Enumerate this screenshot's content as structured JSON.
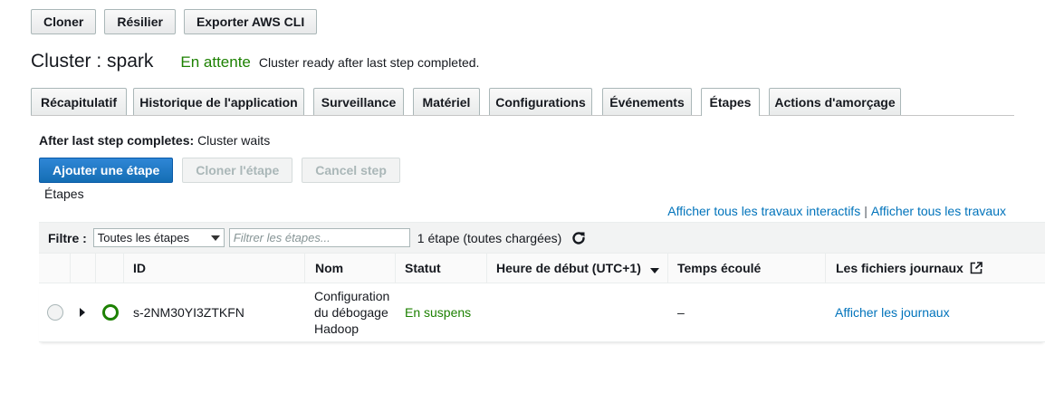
{
  "toolbar": {
    "clone_label": "Cloner",
    "terminate_label": "Résilier",
    "export_label": "Exporter AWS CLI"
  },
  "cluster": {
    "title": "Cluster : spark",
    "state": "En attente",
    "message": "Cluster ready after last step completed."
  },
  "tabs": [
    {
      "label": "Récapitulatif",
      "active": false
    },
    {
      "label": "Historique de l'application",
      "active": false
    },
    {
      "label": "Surveillance",
      "active": false
    },
    {
      "label": "Matériel",
      "active": false
    },
    {
      "label": "Configurations",
      "active": false
    },
    {
      "label": "Événements",
      "active": false
    },
    {
      "label": "Étapes",
      "active": true
    },
    {
      "label": "Actions d'amorçage",
      "active": false
    }
  ],
  "steps_panel": {
    "after_label": "After last step completes:",
    "after_value": "Cluster waits",
    "add_step_label": "Ajouter une étape",
    "clone_step_label": "Cloner l'étape",
    "cancel_step_label": "Cancel step",
    "section_label": "Étapes",
    "link_interactive": "Afficher tous les travaux interactifs",
    "link_separator": "|",
    "link_all_jobs": "Afficher tous les travaux"
  },
  "filter": {
    "label": "Filtre :",
    "selected": "Toutes les étapes",
    "placeholder": "Filtrer les étapes...",
    "count_text": "1 étape (toutes chargées)"
  },
  "table": {
    "columns": [
      "ID",
      "Nom",
      "Statut",
      "Heure de début (UTC+1)",
      "Temps écoulé",
      "Les fichiers journaux"
    ],
    "rows": [
      {
        "id": "s-2NM30YI3ZTKFN",
        "name_lines": [
          "Configuration",
          "du débogage",
          "Hadoop"
        ],
        "status": "En suspens",
        "start_time": "",
        "elapsed": "–",
        "logs": "Afficher les journaux"
      }
    ]
  },
  "colors": {
    "accent_blue": "#0073bb",
    "status_green": "#1d8102",
    "primary_button": "#146eb4"
  },
  "icons": {
    "refresh": "refresh-icon",
    "sort": "sort-descending-icon",
    "external_link": "external-link-icon",
    "expand": "caret-right-icon",
    "state": "pending-circle-icon"
  }
}
